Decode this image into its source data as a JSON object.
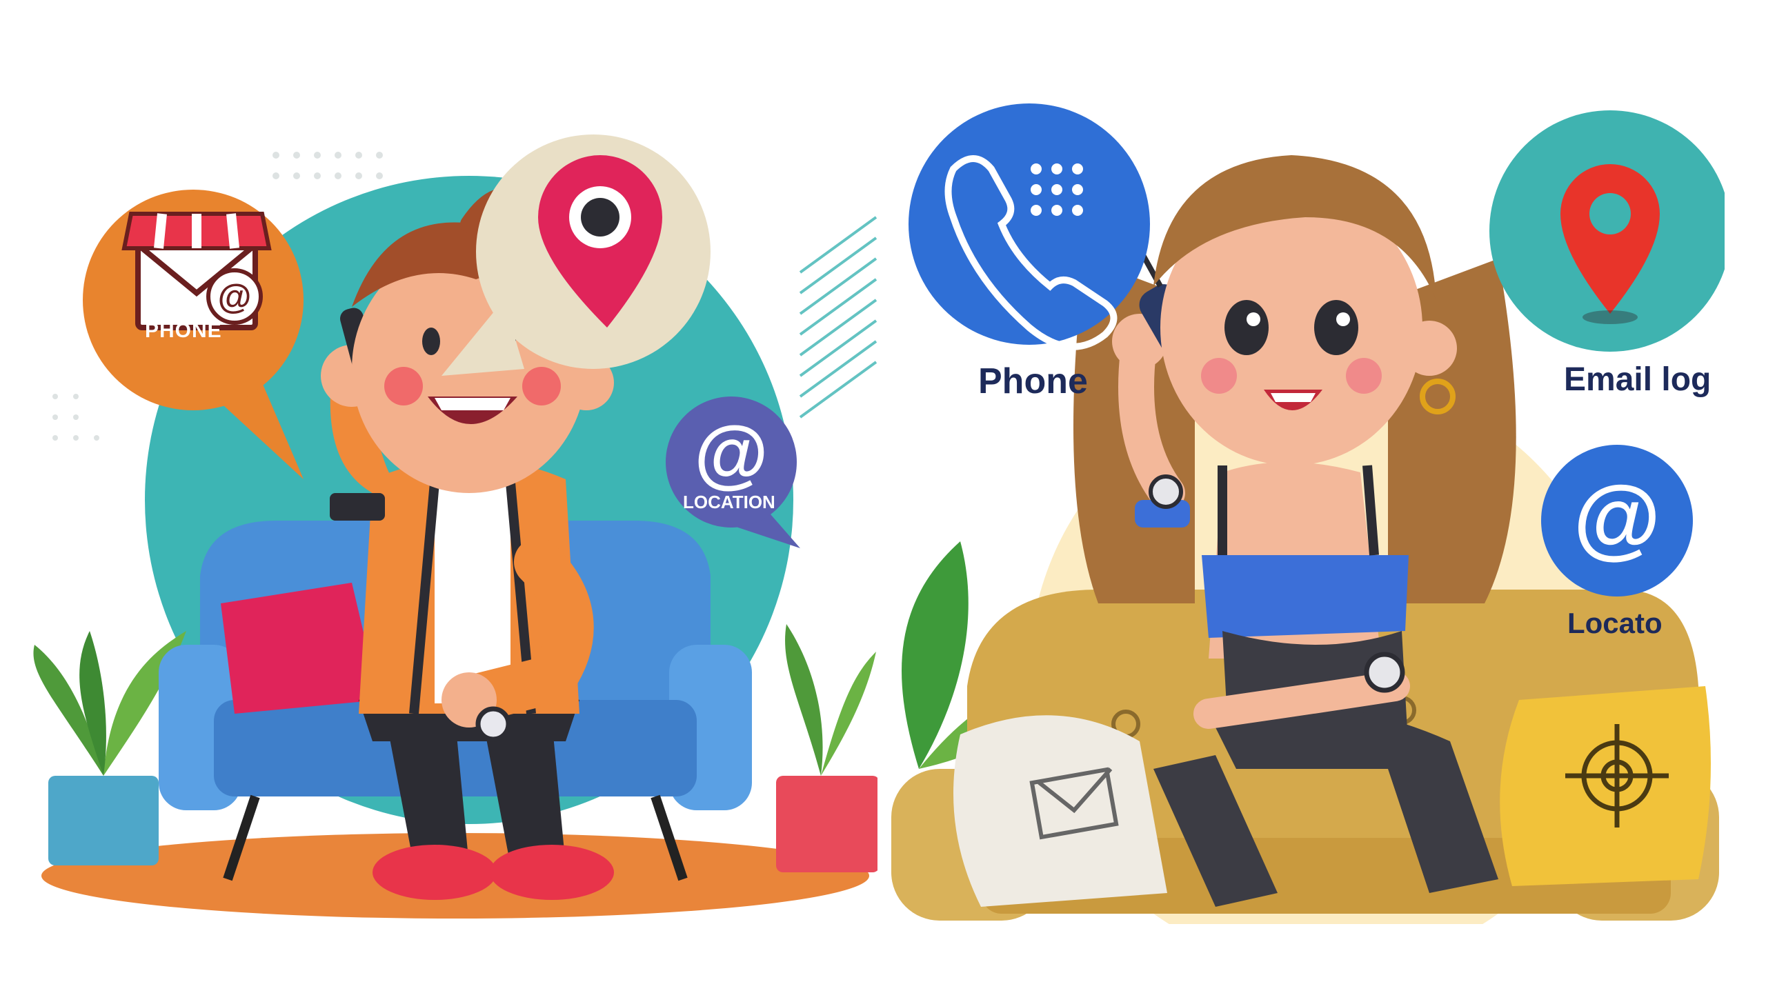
{
  "scene": "two cartoon illustrations side by side",
  "left_panel": {
    "phone_label": "PHONE",
    "location_label": "LOCATION",
    "icons": [
      "storefront-envelope-icon",
      "map-pin-icon",
      "at-sign-icon"
    ]
  },
  "right_panel": {
    "phone_label": "Phone",
    "email_label": "Email log",
    "location_label": "Locato",
    "icons": [
      "phone-handset-icon",
      "map-pin-icon",
      "at-sign-icon",
      "envelope-icon",
      "crosshair-icon"
    ]
  },
  "colors": {
    "left_backdrop": "#3db5b4",
    "left_sofa": "#4a8fd8",
    "left_jacket": "#f08a3a",
    "left_bubble_phone": "#e8842e",
    "left_bubble_at": "#5a5fb0",
    "right_sofa": "#d4a94c",
    "right_top": "#3c6fd8",
    "right_phone_circle": "#2f6fd6",
    "right_pin_circle": "#3fb3b0"
  }
}
